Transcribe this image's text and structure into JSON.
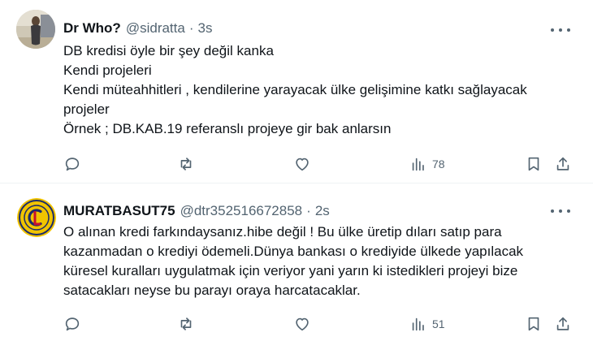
{
  "tweets": [
    {
      "display_name": "Dr Who?",
      "handle": "@sidratta",
      "separator": "·",
      "time": "3s",
      "lines": [
        "DB kredisi öyle bir şey değil kanka",
        "Kendi projeleri",
        "Kendi müteahhitleri , kendilerine yarayacak ülke gelişimine katkı sağlayacak",
        "projeler",
        "Örnek ; DB.KAB.19 referanslı projeye gir bak anlarsın"
      ],
      "views": "78",
      "avatar_icon": "photo-avatar"
    },
    {
      "display_name": "MURATBASUT75",
      "handle": "@dtr352516672858",
      "separator": "·",
      "time": "2s",
      "lines": [
        "O alınan kredi farkındaysanız.hibe değil ! Bu ülke üretip dıları satıp para",
        "kazanmadan o krediyi ödemeli.Dünya bankası o krediyide ülkede yapılacak",
        "küresel kuralları uygulatmak için veriyor yani yarın ki istedikleri projeyi bize",
        "satacakları neyse bu parayı oraya harcatacaklar."
      ],
      "views": "51",
      "avatar_icon": "club-logo-avatar"
    }
  ],
  "colors": {
    "text": "#0f1419",
    "secondary": "#536471",
    "divider": "#eff3f4",
    "logo_gold": "#f1c400",
    "logo_navy": "#1d2b6b"
  }
}
